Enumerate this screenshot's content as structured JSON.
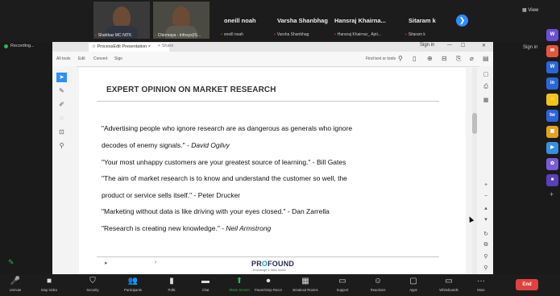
{
  "participants": {
    "video_tiles": [
      {
        "tag": "Shahbaz MC NITK"
      },
      {
        "tag": "Chinmaya - Infosys(IS..."
      }
    ],
    "names": [
      {
        "name": "oneill noah",
        "tag": "oneill noah"
      },
      {
        "name": "Varsha Shanbhag",
        "tag": "Varsha Shanbhag"
      },
      {
        "name": "Hansraj Khairna...",
        "tag": "Hansraj Khairnar_ Apti..."
      },
      {
        "name": "Sitaram k",
        "tag": "Sitaram k"
      }
    ],
    "next_glyph": "❯",
    "view_label": "▦ View"
  },
  "recording_label": "Recording...",
  "app": {
    "tab_label": "☆ ProcessEdit Presentation",
    "tab_close": "×",
    "tab2_label": "+ Share",
    "sign_in": "Sign in",
    "menu": [
      "All tools",
      "Edit",
      "Convert",
      "Sign"
    ],
    "find_text": "Find text or tools",
    "window_controls": [
      "—",
      "☐",
      "✕"
    ]
  },
  "slide": {
    "heading": "EXPERT OPINION ON MARKET RESEARCH",
    "lines": [
      {
        "text": "\"Advertising people who ignore research are as dangerous as generals who ignore",
        "author": ""
      },
      {
        "text": "decodes of enemy signals.\" - ",
        "author": "David Ogilvy"
      },
      {
        "text": "\"Your most unhappy customers are your greatest source of learning.\" - Bill Gates",
        "author": ""
      },
      {
        "text": "\"The aim of market research is to know and understand the customer so well, the",
        "author": ""
      },
      {
        "text": "product or service sells itself.\" - Peter Drucker",
        "author": ""
      },
      {
        "text": "\"Marketing without data is like driving with your eyes closed.\" - Dan Zarrella",
        "author": ""
      },
      {
        "text": "\"Research is creating new knowledge.\" - ",
        "author": "Neil Armstrong"
      }
    ],
    "logo_pre": "PR",
    "logo_o": "O",
    "logo_post": "FOUND",
    "logo_sub": "Knowledge & Skills Studio",
    "nav_left": "▸",
    "nav_right": "›"
  },
  "right_dock": {
    "sign_in": "Sign in",
    "apps": [
      {
        "label": "W",
        "color": "#6a4fd6"
      },
      {
        "label": "✉",
        "color": "#e2563a"
      },
      {
        "label": "W",
        "color": "#2b66d9"
      },
      {
        "label": "in",
        "color": "#2b66d9"
      },
      {
        "label": "☺",
        "color": "#f0c419"
      },
      {
        "label": "tw",
        "color": "#2b66d9"
      },
      {
        "label": "▣",
        "color": "#e0a323"
      },
      {
        "label": "▶",
        "color": "#3b8de0"
      },
      {
        "label": "✿",
        "color": "#7a5bd8"
      },
      {
        "label": "■",
        "color": "#5a3fb8"
      }
    ]
  },
  "bottom_toolbar": [
    {
      "icon": "🎤",
      "label": "Unmute"
    },
    {
      "icon": "■",
      "label": "Stop Video"
    },
    {
      "icon": "⛉",
      "label": "Security"
    },
    {
      "icon": "👥",
      "label": "Participants"
    },
    {
      "icon": "▮",
      "label": "Polls"
    },
    {
      "icon": "▬",
      "label": "Chat"
    },
    {
      "icon": "⬆",
      "label": "Share Screen"
    },
    {
      "icon": "⏺",
      "label": "Pause/Stop Recording"
    },
    {
      "icon": "▦",
      "label": "Breakout Rooms"
    },
    {
      "icon": "▭",
      "label": "Support"
    },
    {
      "icon": "☺",
      "label": "Reactions"
    },
    {
      "icon": "▢",
      "label": "Apps"
    },
    {
      "icon": "▭",
      "label": "Whiteboards"
    },
    {
      "icon": "···",
      "label": "More"
    }
  ],
  "end_label": "End",
  "colors": {
    "accent": "#2d8cff",
    "end": "#e0413f",
    "share": "#2fb54a"
  }
}
